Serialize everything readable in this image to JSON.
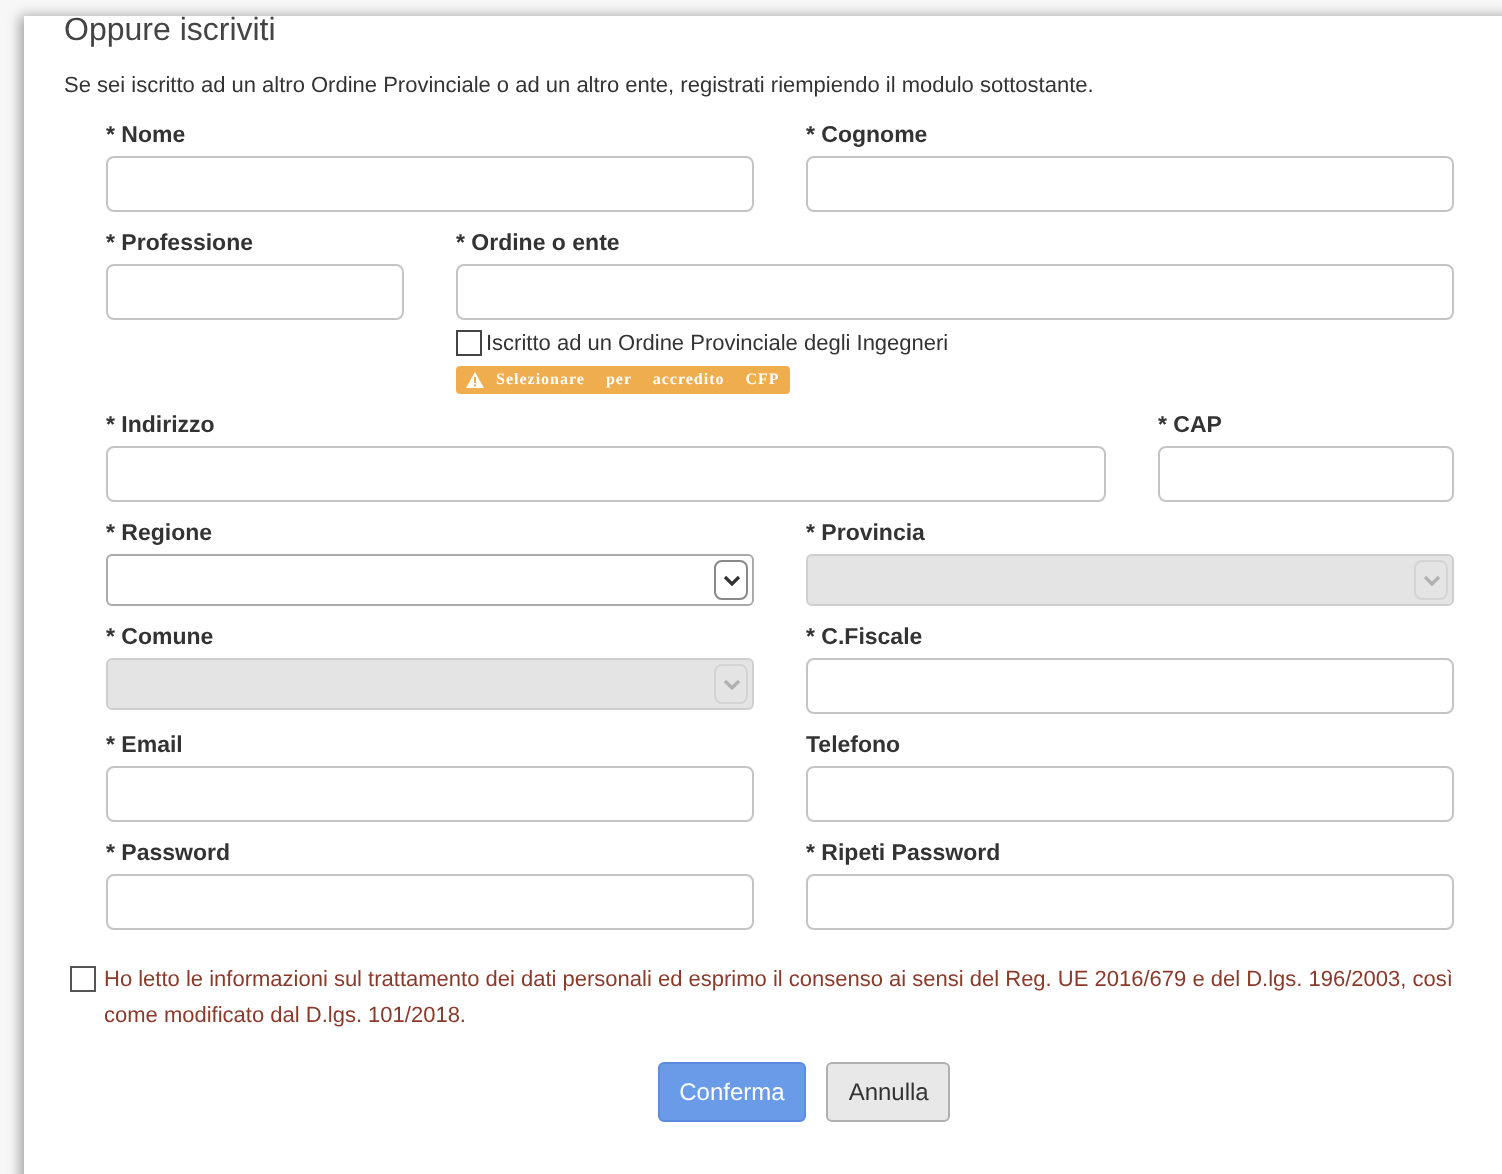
{
  "title": "Oppure iscriviti",
  "intro": "Se sei iscritto ad un altro Ordine Provinciale o ad un altro ente, registrati riempiendo il modulo sottostante.",
  "rows": [
    [
      {
        "label": "* Nome",
        "kind": "text"
      },
      {
        "label": "* Cognome",
        "kind": "text"
      }
    ],
    [
      {
        "label": "* Professione",
        "kind": "text"
      },
      {
        "label": "* Ordine o ente",
        "kind": "text",
        "checkbox": {
          "label": "Iscritto ad un Ordine Provinciale degli Ingegneri",
          "checked": false
        },
        "badge": "Selezionare per accredito CFP"
      }
    ],
    [
      {
        "label": "* Indirizzo",
        "kind": "text"
      },
      {
        "label": "* CAP",
        "kind": "text"
      }
    ],
    [
      {
        "label": "* Regione",
        "kind": "select",
        "disabled": false
      },
      {
        "label": "* Provincia",
        "kind": "select",
        "disabled": true
      }
    ],
    [
      {
        "label": "* Comune",
        "kind": "select",
        "disabled": true
      },
      {
        "label": "* C.Fiscale",
        "kind": "text"
      }
    ],
    [
      {
        "label": "* Email",
        "kind": "text"
      },
      {
        "label": "Telefono",
        "kind": "text"
      }
    ],
    [
      {
        "label": "* Password",
        "kind": "password"
      },
      {
        "label": "* Ripeti Password",
        "kind": "password"
      }
    ]
  ],
  "consent": {
    "text": "Ho letto le informazioni sul trattamento dei dati personali ed esprimo il consenso ai sensi del Reg. UE 2016/679 e del D.lgs. 196/2003, così come modificato dal D.lgs. 101/2018.",
    "checked": false
  },
  "buttons": [
    {
      "label": "Conferma",
      "kind": "primary"
    },
    {
      "label": "Annulla",
      "kind": "secondary"
    }
  ]
}
